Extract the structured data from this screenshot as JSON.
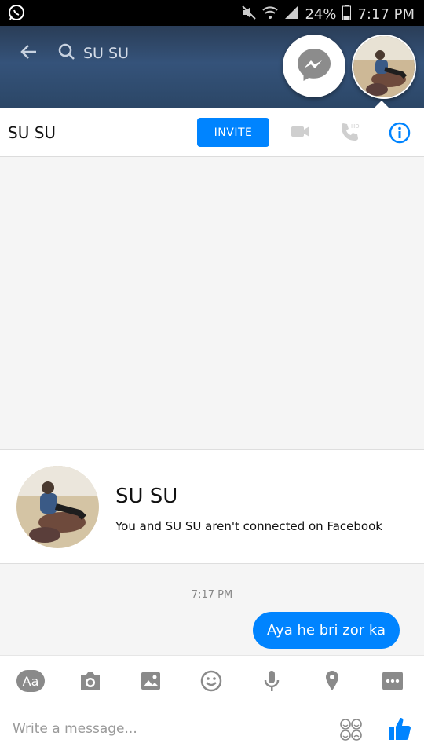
{
  "status_bar": {
    "battery": "24%",
    "time": "7:17 PM",
    "icons": [
      "whatsapp-icon",
      "mute-icon",
      "wifi-icon",
      "signal-icon",
      "battery-icon"
    ]
  },
  "search": {
    "query": "SU SU"
  },
  "header": {
    "contact_name": "SU SU",
    "invite_label": "INVITE",
    "icons": [
      "video-call-icon",
      "hd-voice-call-icon",
      "info-icon"
    ]
  },
  "profile_card": {
    "name": "SU SU",
    "subtitle": "You and SU SU aren't connected on Facebook"
  },
  "conversation": {
    "timestamp": "7:17 PM",
    "message": "Aya he bri zor ka"
  },
  "toolbar": {
    "aa_label": "Aa",
    "icons": [
      "camera-icon",
      "gallery-icon",
      "emoji-icon",
      "microphone-icon",
      "location-icon",
      "more-icon"
    ]
  },
  "composer": {
    "placeholder": "Write a message..."
  },
  "colors": {
    "accent": "#0084ff",
    "header_bg": "#2a3d57"
  }
}
